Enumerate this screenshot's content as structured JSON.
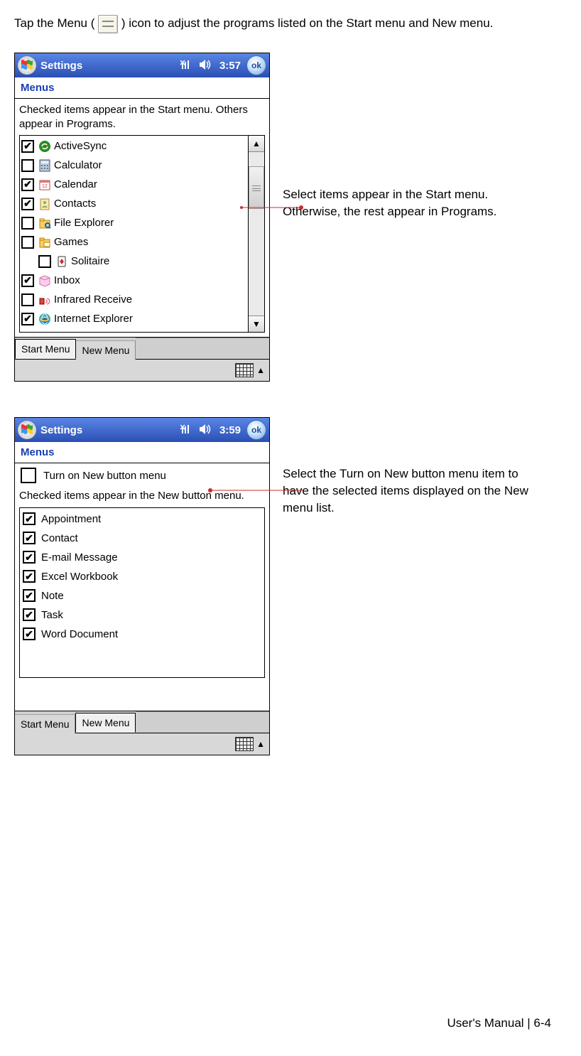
{
  "intro": {
    "before": "Tap the Menu (",
    "after": ") icon to adjust the programs listed on the Start menu and New menu."
  },
  "callouts": {
    "first": "Select items appear in the Start menu. Otherwise, the rest appear in Programs.",
    "second": "Select the Turn on New button menu item to have the selected items displayed on the New menu list."
  },
  "screen1": {
    "titlebar": {
      "title": "Settings",
      "time": "3:57",
      "ok": "ok"
    },
    "headerTitle": "Menus",
    "description": "Checked items appear in the Start menu. Others appear in Programs.",
    "items": [
      {
        "label": "ActiveSync",
        "checked": true,
        "icon": "sync",
        "indent": false
      },
      {
        "label": "Calculator",
        "checked": false,
        "icon": "calc",
        "indent": false
      },
      {
        "label": "Calendar",
        "checked": true,
        "icon": "calendar",
        "indent": false
      },
      {
        "label": "Contacts",
        "checked": true,
        "icon": "contacts",
        "indent": false
      },
      {
        "label": "File Explorer",
        "checked": false,
        "icon": "explorer",
        "indent": false
      },
      {
        "label": "Games",
        "checked": false,
        "icon": "folder",
        "indent": false
      },
      {
        "label": "Solitaire",
        "checked": false,
        "icon": "solitaire",
        "indent": true
      },
      {
        "label": "Inbox",
        "checked": true,
        "icon": "inbox",
        "indent": false
      },
      {
        "label": "Infrared Receive",
        "checked": false,
        "icon": "infrared",
        "indent": false
      },
      {
        "label": "Internet Explorer",
        "checked": true,
        "icon": "ie",
        "indent": false
      }
    ],
    "tabs": {
      "startMenu": "Start Menu",
      "newMenu": "New Menu",
      "active": "Start Menu"
    }
  },
  "screen2": {
    "titlebar": {
      "title": "Settings",
      "time": "3:59",
      "ok": "ok"
    },
    "headerTitle": "Menus",
    "turnOnLabel": "Turn on New button menu",
    "turnOnChecked": false,
    "description": "Checked items appear in the New button menu.",
    "items": [
      {
        "label": "Appointment",
        "checked": true
      },
      {
        "label": "Contact",
        "checked": true
      },
      {
        "label": "E-mail Message",
        "checked": true
      },
      {
        "label": "Excel Workbook",
        "checked": true
      },
      {
        "label": "Note",
        "checked": true
      },
      {
        "label": "Task",
        "checked": true
      },
      {
        "label": "Word Document",
        "checked": true
      }
    ],
    "tabs": {
      "startMenu": "Start Menu",
      "newMenu": "New Menu",
      "active": "New Menu"
    }
  },
  "footer": {
    "text": "User's Manual | 6-4"
  }
}
